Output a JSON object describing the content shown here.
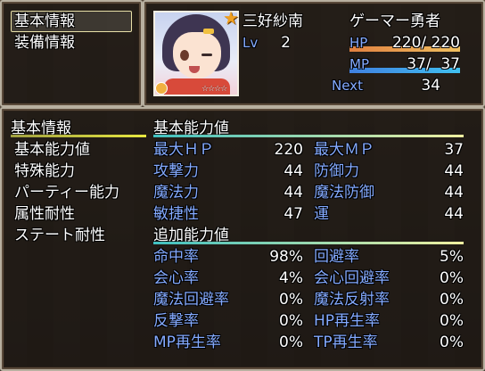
{
  "command": {
    "items": [
      "基本情報",
      "装備情報"
    ],
    "selected_index": 0
  },
  "actor": {
    "name": "三好紗南",
    "class": "ゲーマー勇者",
    "level_label": "Lv",
    "level": "2",
    "hp_label": "HP",
    "hp": "220/ 220",
    "hp_ratio": 1.0,
    "mp_label": "MP",
    "mp": "37/  37",
    "mp_ratio": 1.0,
    "next_label": "Next",
    "next": "34",
    "face_icon": "character-portrait",
    "rank_stars": "☆☆☆☆"
  },
  "tabs": {
    "items": [
      "基本情報",
      "基本能力値",
      "特殊能力",
      "パーティー能力",
      "属性耐性",
      "ステート耐性"
    ]
  },
  "sections": {
    "basic_title": "基本能力値",
    "extra_title": "追加能力値"
  },
  "basic_stats": [
    {
      "l_label": "最大ＨＰ",
      "l_value": "220",
      "r_label": "最大ＭＰ",
      "r_value": "37"
    },
    {
      "l_label": "攻撃力",
      "l_value": "44",
      "r_label": "防御力",
      "r_value": "44"
    },
    {
      "l_label": "魔法力",
      "l_value": "44",
      "r_label": "魔法防御",
      "r_value": "44"
    },
    {
      "l_label": "敏捷性",
      "l_value": "47",
      "r_label": "運",
      "r_value": "44"
    }
  ],
  "extra_stats": [
    {
      "l_label": "命中率",
      "l_value": "98%",
      "r_label": "回避率",
      "r_value": "5%"
    },
    {
      "l_label": "会心率",
      "l_value": "4%",
      "r_label": "会心回避率",
      "r_value": "0%"
    },
    {
      "l_label": "魔法回避率",
      "l_value": "0%",
      "r_label": "魔法反射率",
      "r_value": "0%"
    },
    {
      "l_label": "反撃率",
      "l_value": "0%",
      "r_label": "HP再生率",
      "r_value": "0%"
    },
    {
      "l_label": "MP再生率",
      "l_value": "0%",
      "r_label": "TP再生率",
      "r_value": "0%"
    }
  ],
  "colors": {
    "system": "#84aaff",
    "hp_gauge_start": "#e08040",
    "hp_gauge_end": "#f0c060",
    "mp_gauge_start": "#4080e0",
    "mp_gauge_end": "#40c0f0",
    "tab_underline": "#e8e840",
    "section_underline_start": "#40c0c0",
    "section_underline_end": "#f0f0a0"
  }
}
